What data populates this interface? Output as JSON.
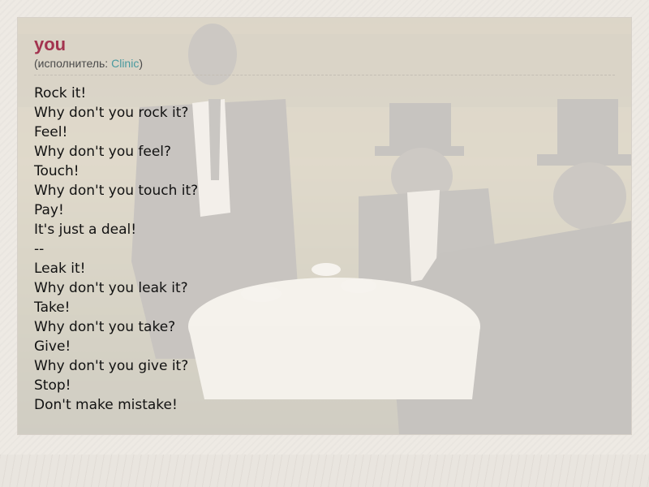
{
  "song": {
    "title": "you",
    "artist_prefix": "(исполнитель: ",
    "artist_name": "Clinic",
    "artist_suffix": ")"
  },
  "lyrics": [
    "Rock it!",
    "Why don't you rock it?",
    "Feel!",
    "Why don't you feel?",
    "Touch!",
    "Why don't you touch it?",
    "Pay!",
    "It's just a deal!",
    "--",
    "Leak it!",
    "Why don't you leak it?",
    "Take!",
    "Why don't you take?",
    "Give!",
    "Why don't you give it?",
    "Stop!",
    "Don't make mistake!"
  ],
  "colors": {
    "title": "#a3334f",
    "artist_link": "#4a9a9f",
    "lyrics_text": "#111111",
    "separator": "#c3bdb4"
  }
}
